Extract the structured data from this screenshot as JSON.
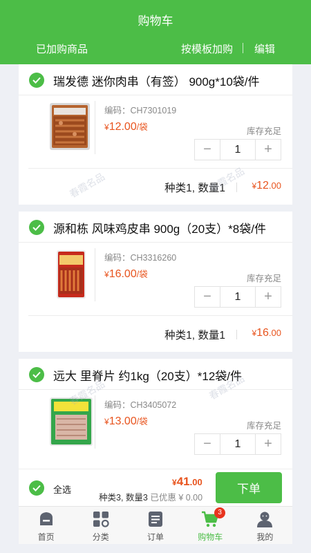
{
  "header": {
    "title": "购物车",
    "purchased_label": "已加购商品",
    "template_label": "按模板加购",
    "edit_label": "编辑"
  },
  "items": [
    {
      "name": "瑞发德 迷你肉串（有签） 900g*10袋/件",
      "code": "编码：CH7301019",
      "price_symbol": "¥",
      "price": "12.00",
      "price_unit": "/袋",
      "stock": "库存充足",
      "minus": "−",
      "qty": "1",
      "plus": "+",
      "summary": "种类1, 数量1",
      "subtotal_int": "12",
      "subtotal_dec": ".00",
      "image": "mini-meat-skewer-package"
    },
    {
      "name": "源和栋 风味鸡皮串 900g（20支）*8袋/件",
      "code": "编码：CH3316260",
      "price_symbol": "¥",
      "price": "16.00",
      "price_unit": "/袋",
      "stock": "库存充足",
      "minus": "−",
      "qty": "1",
      "plus": "+",
      "summary": "种类1, 数量1",
      "subtotal_int": "16",
      "subtotal_dec": ".00",
      "image": "chicken-skin-skewer-package"
    },
    {
      "name": "远大 里脊片 约1kg（20支）*12袋/件",
      "code": "编码：CH3405072",
      "price_symbol": "¥",
      "price": "13.00",
      "price_unit": "/袋",
      "stock": "库存充足",
      "minus": "−",
      "qty": "1",
      "plus": "+",
      "image": "tenderloin-slice-package"
    }
  ],
  "checkout": {
    "select_all": "全选",
    "total_symbol": "¥",
    "total_int": "41",
    "total_dec": ".00",
    "info": "种类3, 数量3",
    "discount": "已优惠 ¥ 0.00",
    "order_label": "下单"
  },
  "tabbar": {
    "tabs": [
      {
        "label": "首页",
        "icon": "home-icon"
      },
      {
        "label": "分类",
        "icon": "category-icon"
      },
      {
        "label": "订单",
        "icon": "order-icon"
      },
      {
        "label": "购物车",
        "icon": "cart-icon",
        "badge": "3",
        "active": true
      },
      {
        "label": "我的",
        "icon": "profile-icon"
      }
    ]
  },
  "watermark": "春霞名品",
  "colors": {
    "brand": "#4cbd47",
    "price": "#e8541e",
    "badge": "#e8341e"
  }
}
